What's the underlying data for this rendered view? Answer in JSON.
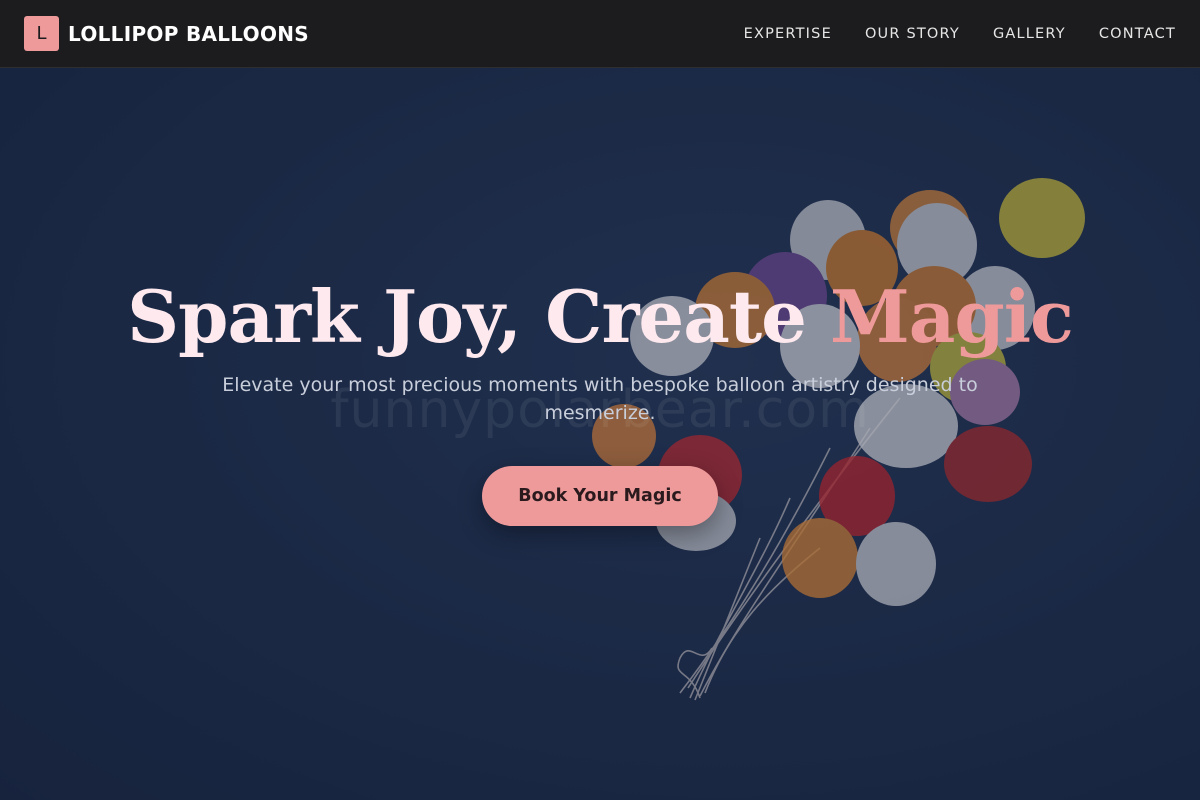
{
  "brand": {
    "logo_letter": "L",
    "name": "LOLLIPOP BALLOONS"
  },
  "nav": {
    "items": [
      "EXPERTISE",
      "OUR STORY",
      "GALLERY",
      "CONTACT"
    ]
  },
  "hero": {
    "title_main": "Spark Joy, Create ",
    "title_accent": "Magic",
    "subtitle": "Elevate your most precious moments with bespoke balloon artistry designed to mesmerize.",
    "cta_label": "Book Your Magic",
    "watermark": "funnypolarbear.com"
  },
  "colors": {
    "accent": "#ef9a9a",
    "navbar": "#1c1c1e",
    "hero_bg": "#1d2c49",
    "title": "#fde9ee"
  }
}
